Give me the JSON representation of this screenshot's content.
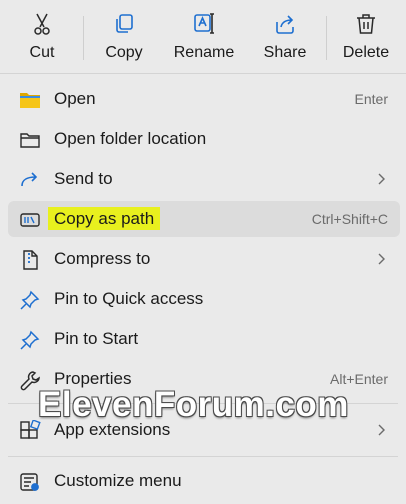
{
  "toolbar": {
    "cut": "Cut",
    "copy": "Copy",
    "rename": "Rename",
    "share": "Share",
    "delete": "Delete"
  },
  "items": {
    "open": {
      "label": "Open",
      "shortcut": "Enter"
    },
    "open_folder": {
      "label": "Open folder location"
    },
    "send_to": {
      "label": "Send to"
    },
    "copy_path": {
      "label": "Copy as path",
      "shortcut": "Ctrl+Shift+C"
    },
    "compress": {
      "label": "Compress to"
    },
    "pin_quick": {
      "label": "Pin to Quick access"
    },
    "pin_start": {
      "label": "Pin to Start"
    },
    "properties": {
      "label": "Properties",
      "shortcut": "Alt+Enter"
    },
    "app_ext": {
      "label": "App extensions"
    },
    "customize": {
      "label": "Customize menu"
    }
  },
  "watermark": "ElevenForum.com",
  "colors": {
    "highlight": "#e8f01e",
    "accent": "#1e6fd0",
    "folder": "#f5c518"
  }
}
